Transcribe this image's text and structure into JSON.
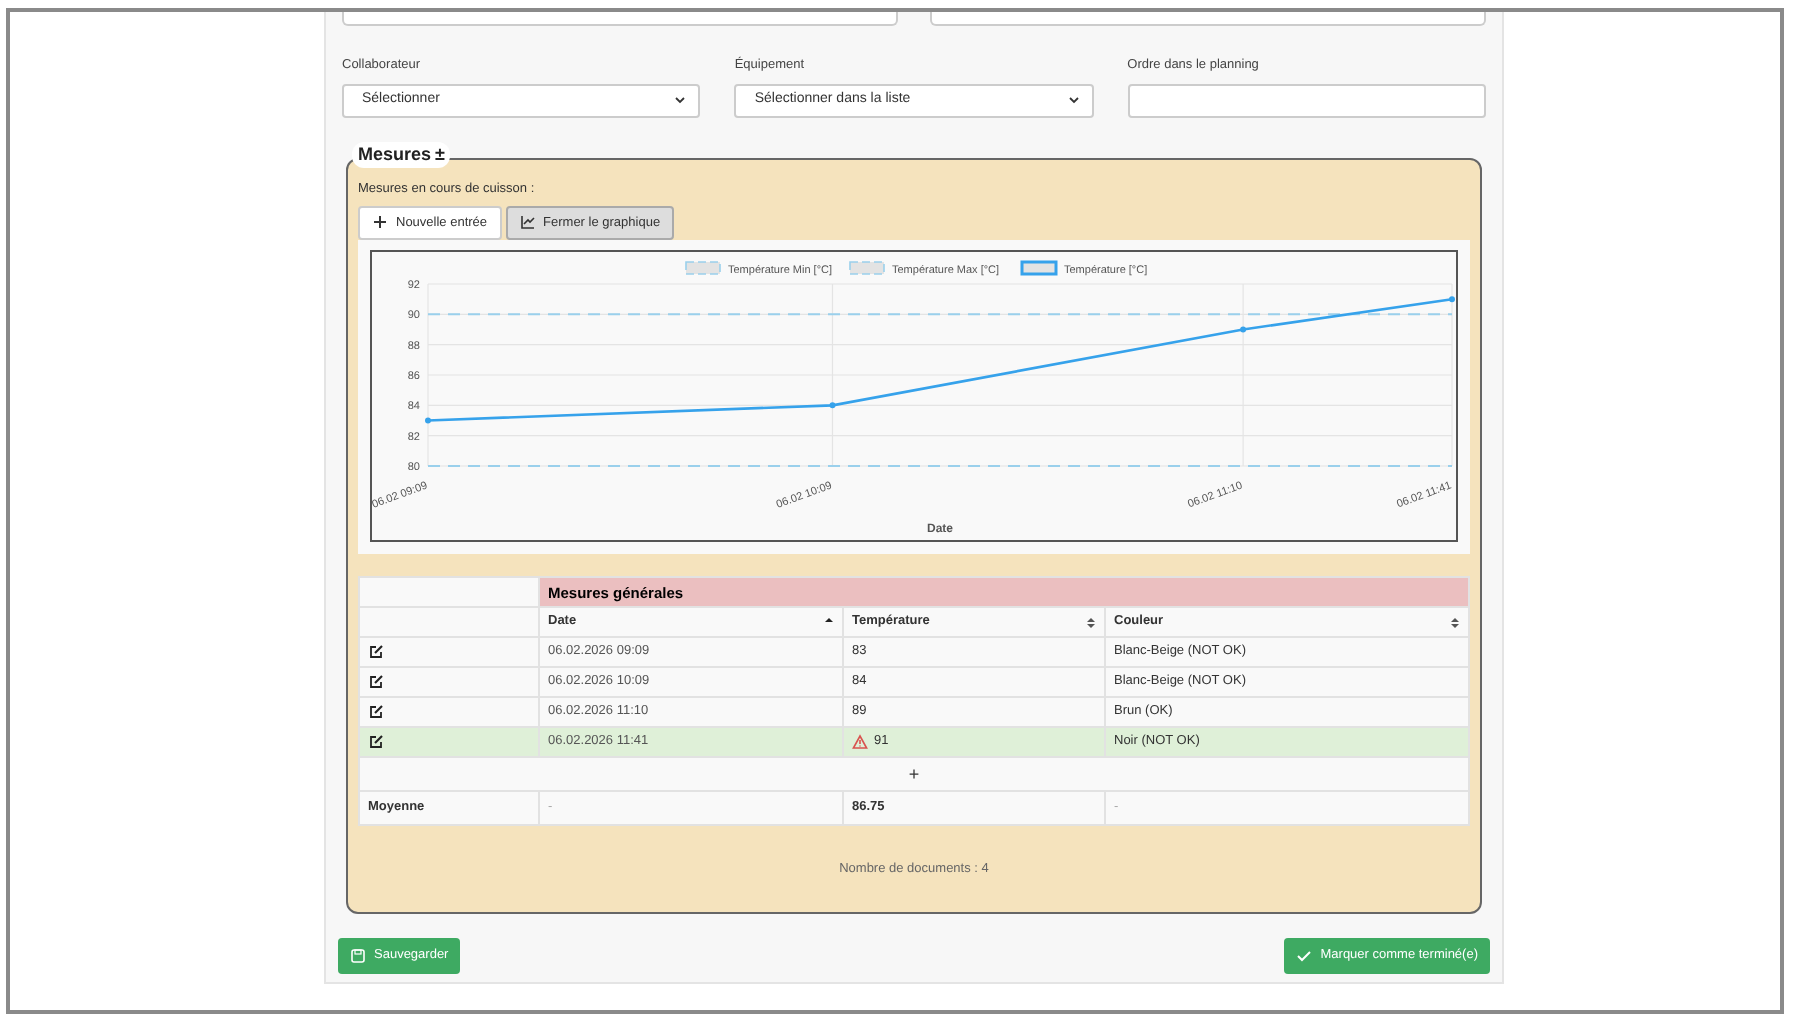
{
  "partial_fields": [
    {
      "kind": "text"
    },
    {
      "kind": "text"
    }
  ],
  "form_fields": [
    {
      "label": "Collaborateur",
      "kind": "select",
      "value": "Sélectionner"
    },
    {
      "label": "Équipement",
      "kind": "select",
      "value": "Sélectionner dans la liste"
    },
    {
      "label": "Ordre dans le planning",
      "kind": "text"
    }
  ],
  "measures": {
    "title": "Mesures",
    "toggle": "±",
    "subtitle": "Mesures en cours de cuisson :",
    "buttons": [
      {
        "label": "Nouvelle entrée",
        "pressed": false
      },
      {
        "label": "Fermer le graphique",
        "pressed": true
      }
    ],
    "chart_data": {
      "type": "line",
      "xlabel": "Date",
      "grid": true,
      "legend": "top",
      "categories": [
        "06.02 09:09",
        "06.02 10:09",
        "06.02 11:10",
        "06.02 11:41"
      ],
      "ylim": [
        80,
        92
      ],
      "yticks": [
        80,
        82,
        84,
        86,
        88,
        90,
        92
      ],
      "series": [
        {
          "name": "Température Min  [°C]",
          "color": "#9ad0ec",
          "line_style": "dashed",
          "marker": "none",
          "values": [
            80,
            80,
            80,
            80
          ]
        },
        {
          "name": "Température Max  [°C]",
          "color": "#9ad0ec",
          "line_style": "dashed",
          "marker": "none",
          "values": [
            90,
            90,
            90,
            90
          ]
        },
        {
          "name": "Température [°C]",
          "color": "#36a2eb",
          "line_style": "solid",
          "marker": "circle",
          "values": [
            83,
            84,
            89,
            91
          ]
        }
      ]
    },
    "table": {
      "group_header": "Mesures générales",
      "columns": [
        {
          "label": "Date",
          "sorted": true
        },
        {
          "label": "Température",
          "sorted": false
        },
        {
          "label": "Couleur",
          "sorted": false
        }
      ],
      "rows": [
        {
          "cells": [
            "06.02.2026 09:09",
            "83",
            "Blanc-Beige (NOT OK)"
          ],
          "highlighted": false,
          "warning": false
        },
        {
          "cells": [
            "06.02.2026 10:09",
            "84",
            "Blanc-Beige (NOT OK)"
          ],
          "highlighted": false,
          "warning": false
        },
        {
          "cells": [
            "06.02.2026 11:10",
            "89",
            "Brun (OK)"
          ],
          "highlighted": false,
          "warning": false
        },
        {
          "cells": [
            "06.02.2026 11:41",
            "91",
            "Noir (NOT OK)"
          ],
          "highlighted": true,
          "warning": true
        }
      ],
      "add_row": "+",
      "footer": {
        "label": "Moyenne",
        "cells": [
          "-",
          "86.75",
          "-"
        ]
      }
    },
    "count": "Nombre de documents : 4"
  },
  "actions": [
    {
      "label": "Sauvegarder"
    },
    {
      "label": "Marquer comme terminé(e)"
    }
  ]
}
